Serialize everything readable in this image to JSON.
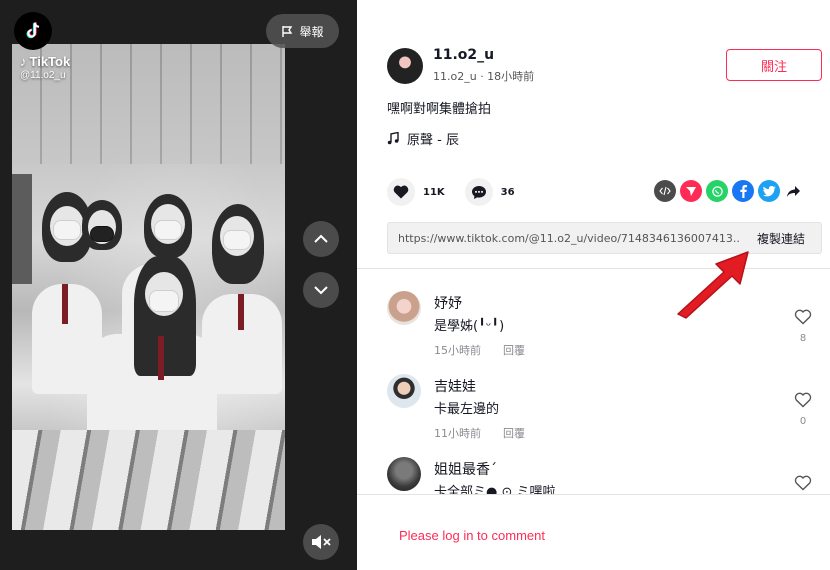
{
  "video": {
    "report_label": "舉報",
    "watermark_brand": "TikTok",
    "watermark_handle": "@11.o2_u"
  },
  "author": {
    "username": "11.o2_u",
    "sub_info": "11.o2_u · 18小時前",
    "follow_label": "關注"
  },
  "post": {
    "caption": "嘿啊對啊集體搶拍",
    "music": "原聲 - 辰"
  },
  "actions": {
    "likes": "11K",
    "comments": "36"
  },
  "share": {
    "icons": [
      "embed-icon",
      "send-icon",
      "whatsapp-icon",
      "facebook-icon",
      "twitter-icon",
      "share-arrow-icon"
    ],
    "colors": {
      "embed": "#4b4b4b",
      "send": "#fe2c55",
      "whatsapp": "#25d366",
      "facebook": "#1877f2",
      "twitter": "#1da1f2"
    }
  },
  "link": {
    "url": "https://www.tiktok.com/@11.o2_u/video/7148346136007413...",
    "copy_label": "複製連結"
  },
  "comments": [
    {
      "name": "妤妤",
      "text": "是學姊(╹ᵕ╹)",
      "time": "15小時前",
      "reply": "回覆",
      "likes": "8"
    },
    {
      "name": "吉娃娃",
      "text": "卡最左邊的",
      "time": "11小時前",
      "reply": "回覆",
      "likes": "0"
    },
    {
      "name": "姐姐最香ˊ",
      "text": "卡全部ミ● ⊙ ミ嘿啦",
      "time": "",
      "reply": "",
      "likes": ""
    }
  ],
  "footer": {
    "login_prompt": "Please log in to comment"
  },
  "colors": {
    "accent": "#fe2c55",
    "annotation_arrow": "#e31b23"
  }
}
